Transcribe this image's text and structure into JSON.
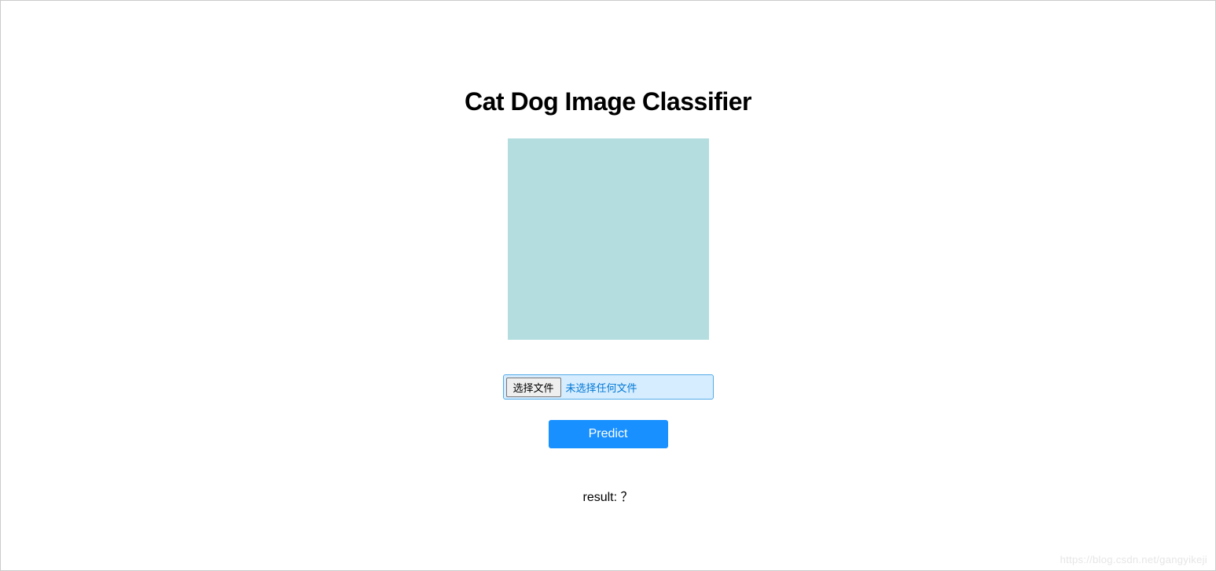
{
  "header": {
    "title": "Cat Dog Image Classifier"
  },
  "fileInput": {
    "chooseButtonLabel": "选择文件",
    "noFileText": "未选择任何文件"
  },
  "actions": {
    "predictLabel": "Predict"
  },
  "result": {
    "label": "result: ",
    "value": "？"
  },
  "watermark": {
    "text": "https://blog.csdn.net/gangyikeji"
  }
}
